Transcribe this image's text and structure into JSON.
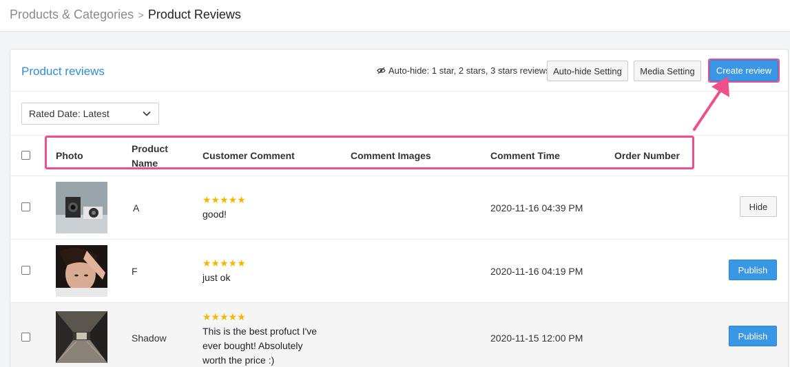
{
  "breadcrumb": {
    "parent": "Products & Categories",
    "separator": ">",
    "current": "Product Reviews"
  },
  "header": {
    "title": "Product reviews",
    "auto_hide_note": "Auto-hide: 1 star, 2 stars, 3 stars reviews",
    "auto_hide_icon": "eye-slash-icon",
    "buttons": {
      "auto_hide_setting": "Auto-hide Setting",
      "media_setting": "Media Setting",
      "create_review": "Create review"
    }
  },
  "filter": {
    "selected": "Rated Date: Latest"
  },
  "table": {
    "columns": {
      "photo": "Photo",
      "product_name_1": "Product",
      "product_name_2": "Name",
      "customer_comment": "Customer Comment",
      "comment_images": "Comment Images",
      "comment_time": "Comment Time",
      "order_number": "Order Number"
    },
    "rows": [
      {
        "product_name": "A",
        "rating": 5,
        "stars": "★★★★★",
        "comment": "good!",
        "comment_time": "2020-11-16 04:39 PM",
        "action": "Hide"
      },
      {
        "product_name": "F",
        "rating": 5,
        "stars": "★★★★★",
        "comment": "just ok",
        "comment_time": "2020-11-16 04:19 PM",
        "action": "Publish"
      },
      {
        "product_name": "Shadow",
        "rating": 5,
        "stars": "★★★★★",
        "comment_line_1": "This is the best profuct I've",
        "comment_line_2": "ever bought! Absolutely",
        "comment_line_3": "worth the price :)",
        "comment_time": "2020-11-15 12:00 PM",
        "action": "Publish"
      }
    ]
  },
  "colors": {
    "accent": "#3a97e6",
    "title_blue": "#2e8fd6",
    "highlight": "#ef4f8b",
    "star": "#f5b800"
  }
}
